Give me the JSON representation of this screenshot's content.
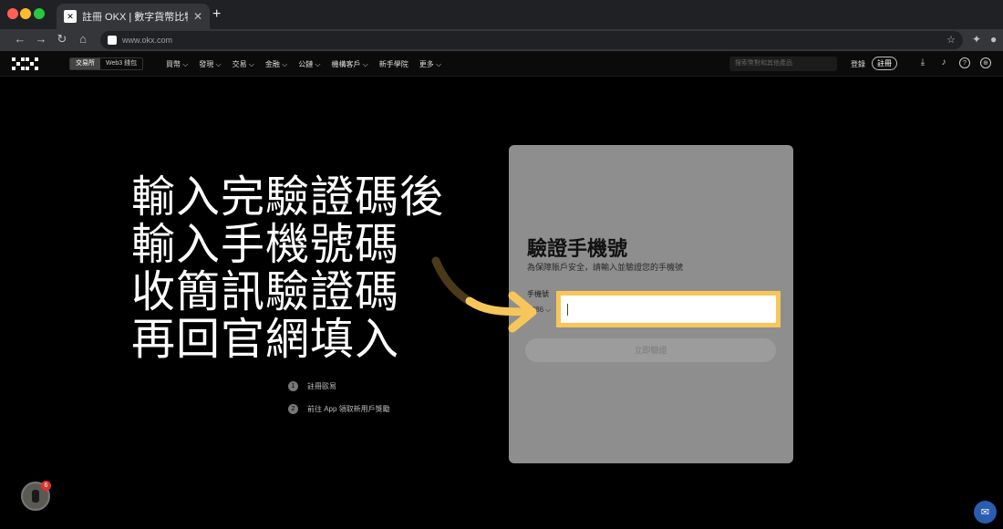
{
  "browser": {
    "tab_title": "註冊 OKX | 數字貨幣比特幣註冊 |",
    "tab_close": "✕",
    "new_tab": "+",
    "url": "www.okx.com"
  },
  "site_nav": {
    "segments": [
      "交易所",
      "Web3 錢包"
    ],
    "menu": [
      "買幣 ⌵",
      "發現 ⌵",
      "交易 ⌵",
      "金融 ⌵",
      "公鏈 ⌵",
      "機構客戶 ⌵",
      "新手學院",
      "更多 ⌵"
    ],
    "search_placeholder": "搜索幣對和其他產品",
    "login": "登錄",
    "register": "註冊"
  },
  "overlay": {
    "lines": [
      "輸入完驗證碼後",
      "輸入手機號碼",
      "收簡訊驗證碼",
      "再回官網填入"
    ]
  },
  "steps": [
    {
      "num": "1",
      "text": "註冊歐易"
    },
    {
      "num": "2",
      "text": "前往 App 領取新用戶獎勵"
    }
  ],
  "form": {
    "title": "驗證手機號",
    "subtitle": "為保障賬戶安全，請輸入並驗證您的手機號",
    "phone_label": "手機號",
    "country_code": "+886 ⌵",
    "phone_value": "",
    "verify_button": "立即驗證"
  },
  "floating": {
    "badge_count": "6"
  },
  "colors": {
    "highlight": "#f7c65a",
    "panel": "#8e8e8e",
    "chat": "#2a5db0"
  }
}
